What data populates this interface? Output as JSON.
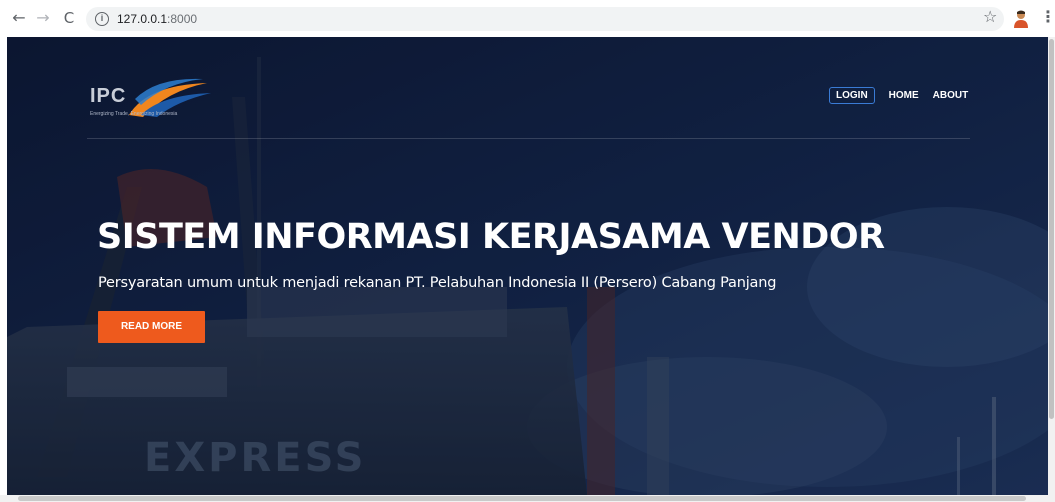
{
  "browser": {
    "url_host": "127.0.0.1",
    "url_port": ":8000",
    "back_glyph": "←",
    "forward_glyph": "→",
    "reload_glyph": "C",
    "info_glyph": "i",
    "star_glyph": "☆",
    "menu_glyph": "⋮",
    "icons": [
      "back-arrow-icon",
      "forward-arrow-icon",
      "reload-icon",
      "info-icon",
      "bookmark-star-icon",
      "profile-avatar-icon",
      "kebab-menu-icon"
    ]
  },
  "site": {
    "logo": {
      "text": "IPC",
      "tagline": "Energizing Trade, Energizing Indonesia"
    },
    "nav": {
      "login": "LOGIN",
      "home": "HOME",
      "about": "ABOUT"
    }
  },
  "hero": {
    "title": "SISTEM INFORMASI KERJASAMA VENDOR",
    "subtitle": "Persyaratan umum untuk menjadi rekanan PT. Pelabuhan Indonesia II (Persero) Cabang Panjang",
    "cta": "READ MORE",
    "ship_lettering": "EXPRESS"
  },
  "colors": {
    "accent_button": "#ee5a1d",
    "login_border": "#3a7bd5",
    "overlay": "#0d1833"
  }
}
